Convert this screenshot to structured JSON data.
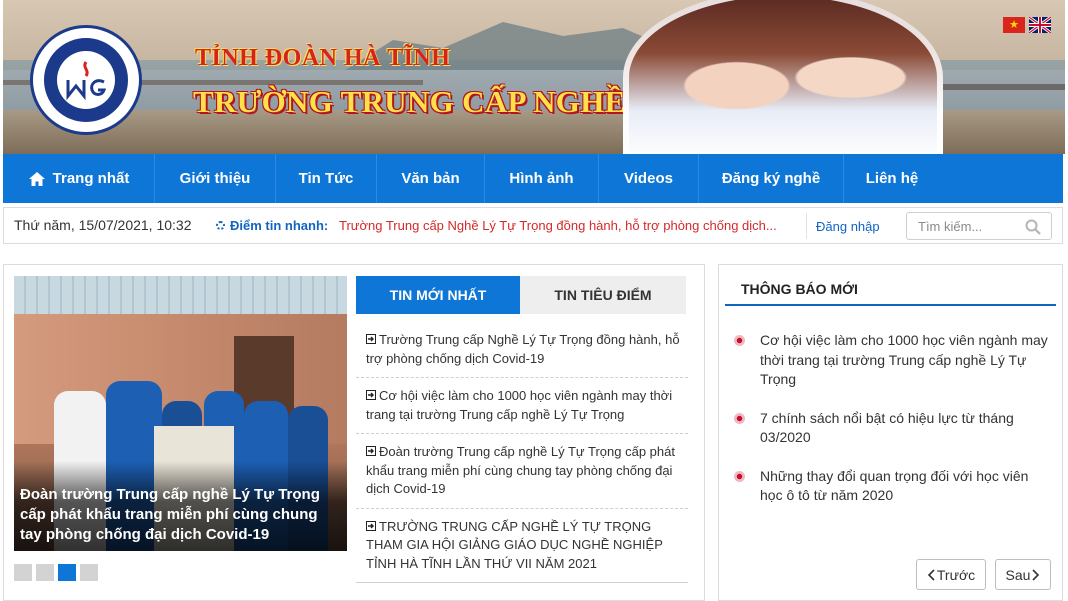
{
  "banner": {
    "title_top": "TỈNH ĐOÀN HÀ TĨNH",
    "title_main": "TRƯỜNG TRUNG CẤP NGHỀ LÝ TỰ TRỌNG",
    "languages": [
      "vietnamese-flag-icon",
      "english-flag-icon"
    ]
  },
  "nav": {
    "items": [
      {
        "label": "Trang nhất",
        "icon": "home-icon"
      },
      {
        "label": "Giới thiệu"
      },
      {
        "label": "Tin Tức"
      },
      {
        "label": "Văn bản"
      },
      {
        "label": "Hình ảnh"
      },
      {
        "label": "Videos"
      },
      {
        "label": "Đăng ký nghề"
      },
      {
        "label": "Liên hệ"
      }
    ]
  },
  "infobar": {
    "date": "Thứ năm, 15/07/2021, 10:32",
    "hot_label": "Điểm tin nhanh:",
    "hot_text": "Trường Trung cấp Nghề Lý Tự Trọng đồng hành, hỗ trợ phòng chống dịch...",
    "login": "Đăng nhập",
    "search_placeholder": "Tìm kiếm..."
  },
  "slider": {
    "caption": "Đoàn trường Trung cấp nghề Lý Tự Trọng cấp phát khẩu trang miễn phí cùng chung tay phòng chống đại dịch Covid-19",
    "active_index": 2,
    "count": 4
  },
  "tabs": [
    {
      "label": "TIN MỚI NHẤT",
      "active": true
    },
    {
      "label": "TIN TIÊU ĐIỂM",
      "active": false
    }
  ],
  "news": [
    "Trường Trung cấp Nghề Lý Tự Trọng đồng hành, hỗ trợ phòng chống dịch Covid-19",
    "Cơ hội việc làm cho 1000 học viên ngành may thời trang tại trường Trung cấp nghề Lý Tự Trọng",
    "Đoàn trường Trung cấp nghề Lý Tự Trọng cấp phát khẩu trang miễn phí cùng chung tay phòng chống đại dịch Covid-19",
    "TRƯỜNG TRUNG CẤP NGHỀ LÝ TỰ TRỌNG THAM GIA HỘI GIẢNG GIÁO DỤC NGHỀ NGHIỆP TỈNH HÀ TĨNH LẦN THỨ VII NĂM 2021"
  ],
  "notices": {
    "title": "THÔNG BÁO MỚI",
    "items": [
      "Cơ hội việc làm cho 1000 học viên ngành may thời trang tại trường Trung cấp nghề Lý Tự Trọng",
      "7 chính sách nổi bật có hiệu lực từ tháng 03/2020",
      "Những thay đổi quan trọng đối với học viên học ô tô từ năm 2020"
    ],
    "prev_label": "Trước",
    "next_label": "Sau"
  },
  "colors": {
    "nav_bg": "#0e76d6",
    "accent_blue": "#1264c2",
    "hot_red": "#d42a2a",
    "notice_dot": "#c8102e"
  }
}
